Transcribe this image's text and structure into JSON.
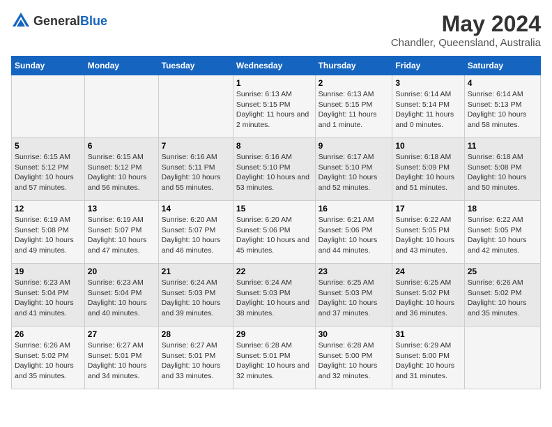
{
  "header": {
    "logo_general": "General",
    "logo_blue": "Blue",
    "title": "May 2024",
    "subtitle": "Chandler, Queensland, Australia"
  },
  "days_of_week": [
    "Sunday",
    "Monday",
    "Tuesday",
    "Wednesday",
    "Thursday",
    "Friday",
    "Saturday"
  ],
  "weeks": [
    {
      "cells": [
        {
          "day": "",
          "info": ""
        },
        {
          "day": "",
          "info": ""
        },
        {
          "day": "",
          "info": ""
        },
        {
          "day": "1",
          "info": "Sunrise: 6:13 AM\nSunset: 5:15 PM\nDaylight: 11 hours and 2 minutes."
        },
        {
          "day": "2",
          "info": "Sunrise: 6:13 AM\nSunset: 5:15 PM\nDaylight: 11 hours and 1 minute."
        },
        {
          "day": "3",
          "info": "Sunrise: 6:14 AM\nSunset: 5:14 PM\nDaylight: 11 hours and 0 minutes."
        },
        {
          "day": "4",
          "info": "Sunrise: 6:14 AM\nSunset: 5:13 PM\nDaylight: 10 hours and 58 minutes."
        }
      ]
    },
    {
      "cells": [
        {
          "day": "5",
          "info": "Sunrise: 6:15 AM\nSunset: 5:12 PM\nDaylight: 10 hours and 57 minutes."
        },
        {
          "day": "6",
          "info": "Sunrise: 6:15 AM\nSunset: 5:12 PM\nDaylight: 10 hours and 56 minutes."
        },
        {
          "day": "7",
          "info": "Sunrise: 6:16 AM\nSunset: 5:11 PM\nDaylight: 10 hours and 55 minutes."
        },
        {
          "day": "8",
          "info": "Sunrise: 6:16 AM\nSunset: 5:10 PM\nDaylight: 10 hours and 53 minutes."
        },
        {
          "day": "9",
          "info": "Sunrise: 6:17 AM\nSunset: 5:10 PM\nDaylight: 10 hours and 52 minutes."
        },
        {
          "day": "10",
          "info": "Sunrise: 6:18 AM\nSunset: 5:09 PM\nDaylight: 10 hours and 51 minutes."
        },
        {
          "day": "11",
          "info": "Sunrise: 6:18 AM\nSunset: 5:08 PM\nDaylight: 10 hours and 50 minutes."
        }
      ]
    },
    {
      "cells": [
        {
          "day": "12",
          "info": "Sunrise: 6:19 AM\nSunset: 5:08 PM\nDaylight: 10 hours and 49 minutes."
        },
        {
          "day": "13",
          "info": "Sunrise: 6:19 AM\nSunset: 5:07 PM\nDaylight: 10 hours and 47 minutes."
        },
        {
          "day": "14",
          "info": "Sunrise: 6:20 AM\nSunset: 5:07 PM\nDaylight: 10 hours and 46 minutes."
        },
        {
          "day": "15",
          "info": "Sunrise: 6:20 AM\nSunset: 5:06 PM\nDaylight: 10 hours and 45 minutes."
        },
        {
          "day": "16",
          "info": "Sunrise: 6:21 AM\nSunset: 5:06 PM\nDaylight: 10 hours and 44 minutes."
        },
        {
          "day": "17",
          "info": "Sunrise: 6:22 AM\nSunset: 5:05 PM\nDaylight: 10 hours and 43 minutes."
        },
        {
          "day": "18",
          "info": "Sunrise: 6:22 AM\nSunset: 5:05 PM\nDaylight: 10 hours and 42 minutes."
        }
      ]
    },
    {
      "cells": [
        {
          "day": "19",
          "info": "Sunrise: 6:23 AM\nSunset: 5:04 PM\nDaylight: 10 hours and 41 minutes."
        },
        {
          "day": "20",
          "info": "Sunrise: 6:23 AM\nSunset: 5:04 PM\nDaylight: 10 hours and 40 minutes."
        },
        {
          "day": "21",
          "info": "Sunrise: 6:24 AM\nSunset: 5:03 PM\nDaylight: 10 hours and 39 minutes."
        },
        {
          "day": "22",
          "info": "Sunrise: 6:24 AM\nSunset: 5:03 PM\nDaylight: 10 hours and 38 minutes."
        },
        {
          "day": "23",
          "info": "Sunrise: 6:25 AM\nSunset: 5:03 PM\nDaylight: 10 hours and 37 minutes."
        },
        {
          "day": "24",
          "info": "Sunrise: 6:25 AM\nSunset: 5:02 PM\nDaylight: 10 hours and 36 minutes."
        },
        {
          "day": "25",
          "info": "Sunrise: 6:26 AM\nSunset: 5:02 PM\nDaylight: 10 hours and 35 minutes."
        }
      ]
    },
    {
      "cells": [
        {
          "day": "26",
          "info": "Sunrise: 6:26 AM\nSunset: 5:02 PM\nDaylight: 10 hours and 35 minutes."
        },
        {
          "day": "27",
          "info": "Sunrise: 6:27 AM\nSunset: 5:01 PM\nDaylight: 10 hours and 34 minutes."
        },
        {
          "day": "28",
          "info": "Sunrise: 6:27 AM\nSunset: 5:01 PM\nDaylight: 10 hours and 33 minutes."
        },
        {
          "day": "29",
          "info": "Sunrise: 6:28 AM\nSunset: 5:01 PM\nDaylight: 10 hours and 32 minutes."
        },
        {
          "day": "30",
          "info": "Sunrise: 6:28 AM\nSunset: 5:00 PM\nDaylight: 10 hours and 32 minutes."
        },
        {
          "day": "31",
          "info": "Sunrise: 6:29 AM\nSunset: 5:00 PM\nDaylight: 10 hours and 31 minutes."
        },
        {
          "day": "",
          "info": ""
        }
      ]
    }
  ]
}
